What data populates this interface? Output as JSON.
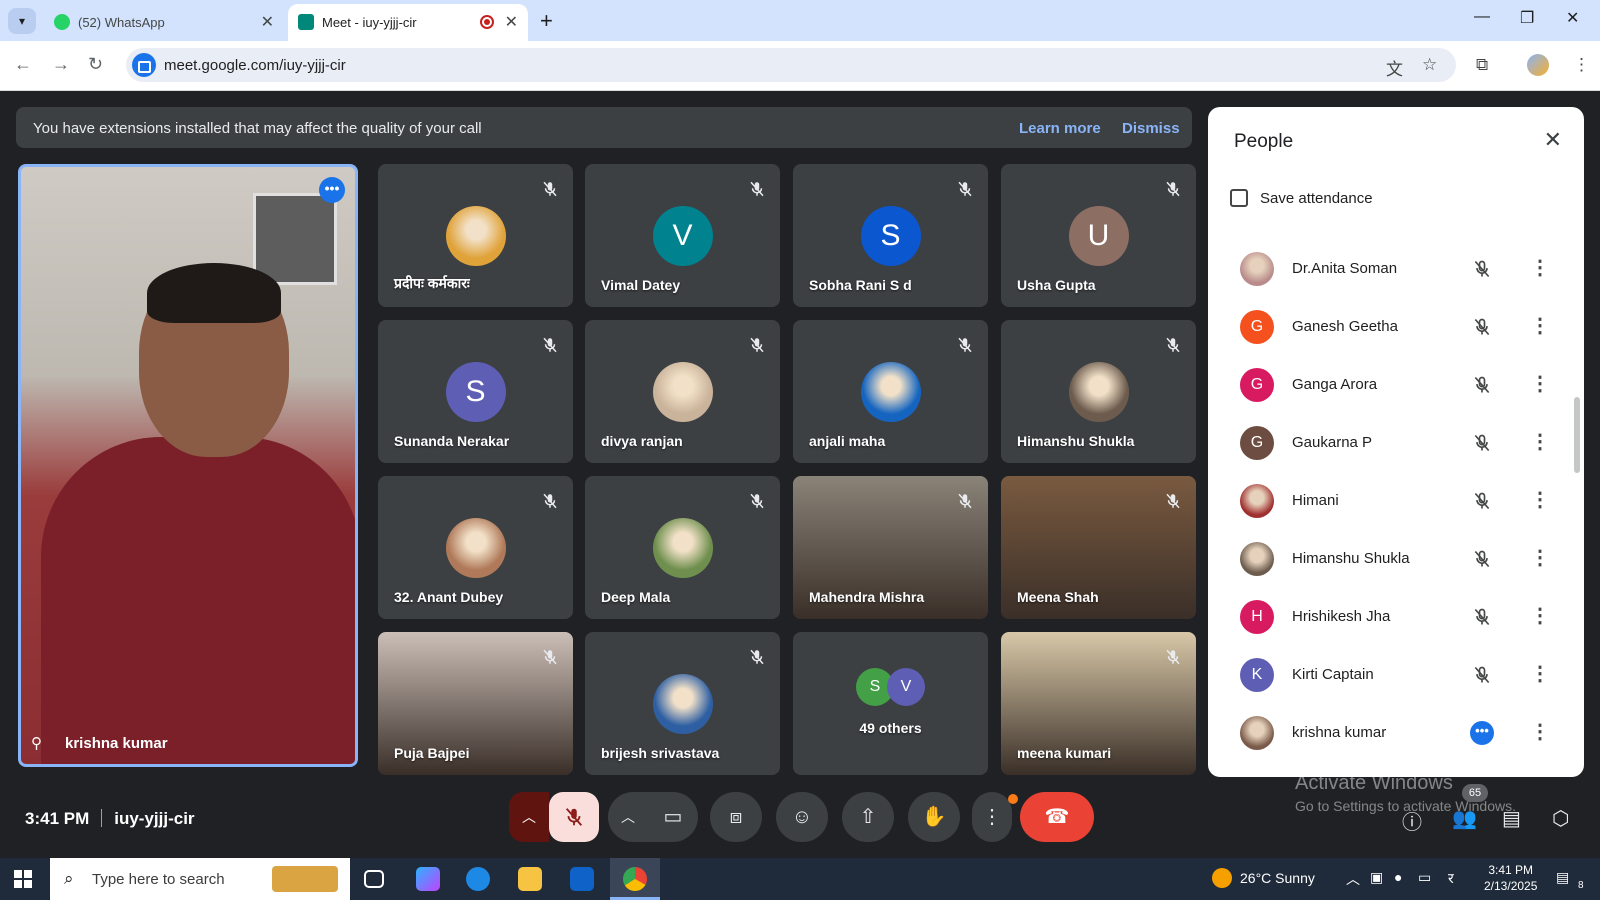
{
  "browser": {
    "tabs": [
      {
        "label": "(52) WhatsApp",
        "favicon": "whatsapp-icon",
        "color": "#25d366"
      },
      {
        "label": "Meet - iuy-yjjj-cir",
        "favicon": "google-meet-icon",
        "color": "#00897b"
      }
    ],
    "url": "meet.google.com/iuy-yjjj-cir"
  },
  "banner": {
    "message": "You have extensions installed that may affect the quality of your call",
    "learn_more": "Learn more",
    "dismiss": "Dismiss"
  },
  "main_participant": {
    "name": "krishna kumar"
  },
  "tiles": [
    {
      "name": "प्रदीपः कर्मकारः",
      "type": "photo",
      "color": "#e0a33a"
    },
    {
      "name": "Vimal Datey",
      "type": "initial",
      "initial": "V",
      "color": "#00838f"
    },
    {
      "name": "Sobha Rani S d",
      "type": "initial",
      "initial": "S",
      "color": "#0b57d0"
    },
    {
      "name": "Usha Gupta",
      "type": "initial",
      "initial": "U",
      "color": "#8d6e63"
    },
    {
      "name": "Sunanda Nerakar",
      "type": "initial",
      "initial": "S",
      "color": "#5e5eb5"
    },
    {
      "name": "divya ranjan",
      "type": "photo",
      "color": "#c9b39a"
    },
    {
      "name": "anjali maha",
      "type": "photo",
      "color": "#1565c0"
    },
    {
      "name": "Himanshu Shukla",
      "type": "photo",
      "color": "#6d5c4e"
    },
    {
      "name": "32. Anant Dubey",
      "type": "photo",
      "color": "#b07a5a"
    },
    {
      "name": "Deep Mala",
      "type": "photo",
      "color": "#6f8f4e"
    },
    {
      "name": "Mahendra Mishra",
      "type": "video",
      "color": "#8a8378"
    },
    {
      "name": "Meena Shah",
      "type": "video",
      "color": "#7a5a40"
    },
    {
      "name": "Puja Bajpei",
      "type": "video",
      "color": "#cbbfb8"
    },
    {
      "name": "brijesh srivastava",
      "type": "photo",
      "color": "#2e5fa3"
    },
    {
      "name": "49 others",
      "type": "others",
      "initials": [
        "S",
        "V"
      ],
      "colors": [
        "#43a047",
        "#5e5eb5"
      ]
    },
    {
      "name": "meena kumari",
      "type": "video",
      "color": "#d8c8a8"
    }
  ],
  "people_panel": {
    "title": "People",
    "save_attendance": "Save attendance",
    "participants": [
      {
        "name": "Dr.Anita Soman",
        "avatar": "photo",
        "color": "#b98b8b"
      },
      {
        "name": "Ganesh Geetha",
        "avatar": "G",
        "color": "#f4511e"
      },
      {
        "name": "Ganga Arora",
        "avatar": "G",
        "color": "#d81b60"
      },
      {
        "name": "Gaukarna P",
        "avatar": "G",
        "color": "#6d4c41"
      },
      {
        "name": "Himani",
        "avatar": "photo",
        "color": "#a03030"
      },
      {
        "name": "Himanshu Shukla",
        "avatar": "photo",
        "color": "#6d5c4e"
      },
      {
        "name": "Hrishikesh Jha",
        "avatar": "H",
        "color": "#d81b60"
      },
      {
        "name": "Kirti Captain",
        "avatar": "K",
        "color": "#5e5eb5"
      },
      {
        "name": "krishna kumar",
        "avatar": "photo",
        "color": "#7a5a4a",
        "speaking": true
      }
    ]
  },
  "controls": {
    "time": "3:41 PM",
    "meeting_code": "iuy-yjjj-cir",
    "people_count": "65"
  },
  "watermark": {
    "line1": "Activate Windows",
    "line2": "Go to Settings to activate Windows."
  },
  "taskbar": {
    "search_placeholder": "Type here to search",
    "weather": "26°C  Sunny",
    "time": "3:41 PM",
    "date": "2/13/2025",
    "notifications": "8"
  }
}
